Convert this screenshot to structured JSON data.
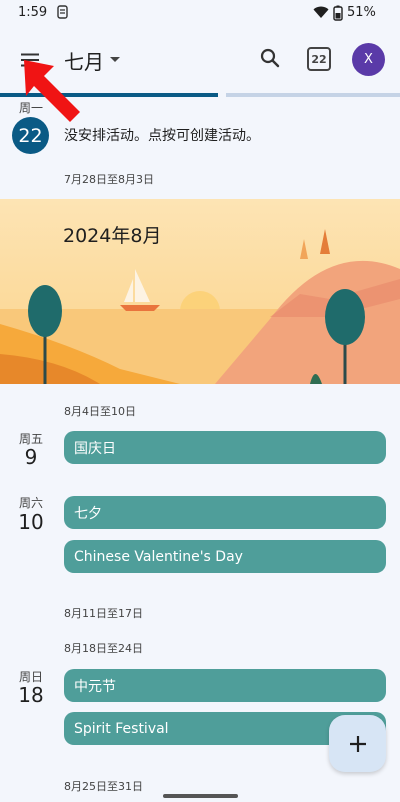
{
  "status_bar": {
    "time": "1:59",
    "battery": "51%"
  },
  "app_bar": {
    "title": "七月",
    "today_date": "22",
    "avatar_letter": "X"
  },
  "agenda": {
    "today": {
      "weekday": "周一",
      "day": "22",
      "empty_text": "没安排活动。点按可创建活动。"
    },
    "week1": "7月28日至8月3日",
    "banner_title": "2024年8月",
    "week2": "8月4日至10日",
    "day_fri": {
      "weekday": "周五",
      "day": "9",
      "events": [
        "国庆日"
      ]
    },
    "day_sat": {
      "weekday": "周六",
      "day": "10",
      "events": [
        "七夕",
        "Chinese Valentine's Day"
      ]
    },
    "week3": "8月11日至17日",
    "week4": "8月18日至24日",
    "day_sun": {
      "weekday": "周日",
      "day": "18",
      "events": [
        "中元节",
        "Spirit Festival"
      ]
    },
    "week5": "8月25日至31日"
  },
  "colors": {
    "accent": "#0a5a85",
    "event": "#4f9e9a",
    "avatar": "#5a3aa8",
    "fab": "#d7e5f5"
  }
}
